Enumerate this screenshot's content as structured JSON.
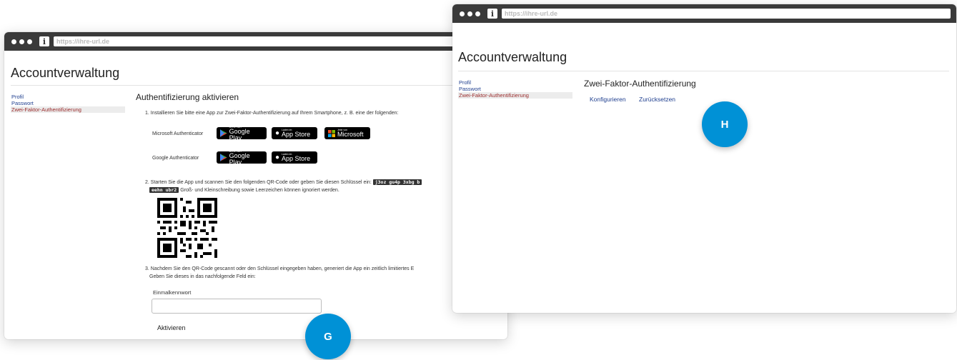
{
  "left_window": {
    "url": "https://ihre-url.de",
    "title": "Accountverwaltung",
    "nav": [
      "Profil",
      "Passwort",
      "Zwei-Faktor-Authentifizierung"
    ],
    "heading": "Authentifizierung aktivieren",
    "step1": "1. Installieren Sie bitte eine App zur Zwei-Faktor-Authentifizierung auf Ihrem Smartphone, z. B. eine der folgenden:",
    "apps": [
      {
        "name": "Microsoft Authenticator"
      },
      {
        "name": "Google Authenticator"
      }
    ],
    "badges": {
      "google_small": "JETZT BEI",
      "google_big": "Google Play",
      "apple_small": "Laden im",
      "apple_big": "App Store",
      "ms_small": "Jetzt von",
      "ms_big": "Microsoft"
    },
    "step2_pre": "2. Starten Sie die App und scannen Sie den folgenden QR-Code oder geben Sie diesen Schlüssel ein:",
    "key_part1": "j3oz gu4p 3xbg b",
    "key_part2": "eehn ubr2",
    "step2_post": "Groß- und Kleinschreibung sowie Leerzeichen können ignoriert werden.",
    "step3_line1": "3. Nachdem Sie den QR-Code gescannt oder den Schlüssel eingegeben haben, generiert die App ein zeitlich limitiertes E",
    "step3_line2": "Geben Sie dieses in das nachfolgende Feld ein:",
    "field_label": "Einmalkennwort",
    "field_value": "",
    "submit": "Aktivieren"
  },
  "right_window": {
    "url": "https://ihre-url.de",
    "title": "Accountverwaltung",
    "nav": [
      "Profil",
      "Passwort",
      "Zwei-Faktor-Authentifizierung"
    ],
    "heading": "Zwei-Faktor-Authentifizierung",
    "actions": [
      "Konfigurieren",
      "Zurücksetzen"
    ]
  },
  "markers": {
    "g": "G",
    "h": "H"
  },
  "colors": {
    "marker": "#0091d6",
    "link": "#1f3f8f",
    "active_nav": "#9b2c2c",
    "titlebar": "#3a3a3a"
  }
}
